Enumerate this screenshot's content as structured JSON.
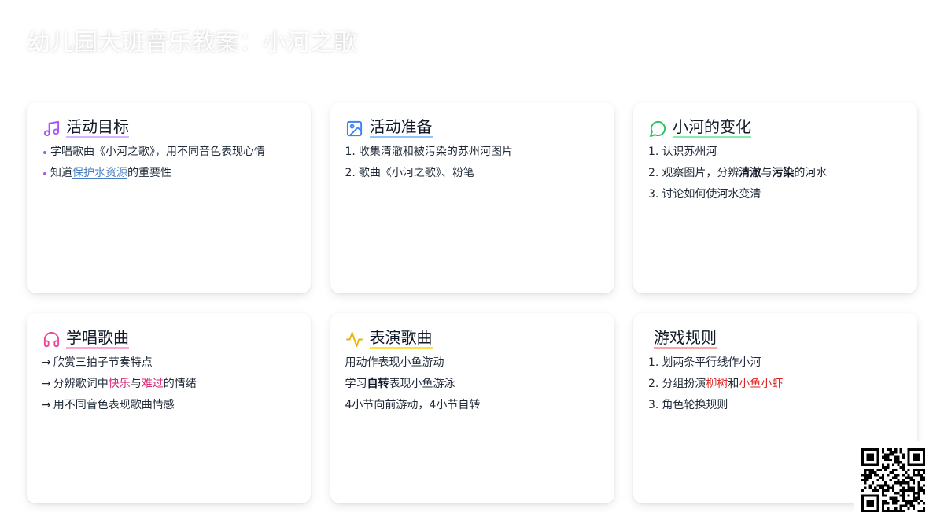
{
  "page": {
    "title": "幼儿园大班音乐教案：小河之歌"
  },
  "colors": {
    "page_background": "#ffffff",
    "text": "#1f2937",
    "heading": "#111827"
  },
  "cards": [
    {
      "icon": "music-icon",
      "title": "活动目标",
      "accent": "#a855f7",
      "underline": "#d8b4fe",
      "link_color": "#4a7fc1",
      "items": [
        {
          "segments": [
            {
              "text": "学唱歌曲《小河之歌》，用不同音色表现心情"
            }
          ]
        },
        {
          "segments": [
            {
              "text": "知道"
            },
            {
              "text": "保护水资源",
              "link": true
            },
            {
              "text": "的重要性"
            }
          ]
        }
      ]
    },
    {
      "icon": "image-icon",
      "title": "活动准备",
      "accent": "#3b82f6",
      "underline": "#93c5fd",
      "items": [
        {
          "marker": "1.",
          "segments": [
            {
              "text": "收集清澈和被污染的苏州河图片"
            }
          ]
        },
        {
          "marker": "2.",
          "segments": [
            {
              "text": "歌曲《小河之歌》、粉笔"
            }
          ]
        }
      ]
    },
    {
      "icon": "message-circle-icon",
      "title": "小河的变化",
      "accent": "#22c55e",
      "underline": "#86efac",
      "items": [
        {
          "marker": "1.",
          "segments": [
            {
              "text": "认识苏州河"
            }
          ]
        },
        {
          "marker": "2.",
          "segments": [
            {
              "text": "观察图片，分辨"
            },
            {
              "text": "清澈",
              "bold": true
            },
            {
              "text": "与"
            },
            {
              "text": "污染",
              "bold": true
            },
            {
              "text": "的河水"
            }
          ]
        },
        {
          "marker": "3.",
          "segments": [
            {
              "text": "讨论如何使河水变清"
            }
          ]
        }
      ]
    },
    {
      "icon": "headphones-icon",
      "title": "学唱歌曲",
      "accent": "#ec4899",
      "underline": "#f9a8d4",
      "link_color": "#db2777",
      "items": [
        {
          "marker": "→",
          "segments": [
            {
              "text": "欣赏三拍子节奏特点"
            }
          ]
        },
        {
          "marker": "→",
          "segments": [
            {
              "text": "分辨歌词中"
            },
            {
              "text": "快乐",
              "link": true
            },
            {
              "text": "与"
            },
            {
              "text": "难过",
              "link": true
            },
            {
              "text": "的情绪"
            }
          ]
        },
        {
          "marker": "→",
          "segments": [
            {
              "text": "用不同音色表现歌曲情感"
            }
          ]
        }
      ]
    },
    {
      "icon": "activity-icon",
      "title": "表演歌曲",
      "accent": "#eab308",
      "underline": "#fde047",
      "items": [
        {
          "segments": [
            {
              "text": "用动作表现小鱼游动"
            }
          ]
        },
        {
          "segments": [
            {
              "text": "学习"
            },
            {
              "text": "自转",
              "bold": true
            },
            {
              "text": "表现小鱼游泳"
            }
          ]
        },
        {
          "segments": [
            {
              "text": "4小节向前游动，4小节自转"
            }
          ]
        }
      ]
    },
    {
      "title": "游戏规则",
      "underline": "#fca5a5",
      "link_color": "#dc2626",
      "items": [
        {
          "marker": "1.",
          "segments": [
            {
              "text": "划两条平行线作小河"
            }
          ]
        },
        {
          "marker": "2.",
          "segments": [
            {
              "text": "分组扮演"
            },
            {
              "text": "柳树",
              "link": true
            },
            {
              "text": "和"
            },
            {
              "text": "小鱼小虾",
              "link": true
            }
          ]
        },
        {
          "marker": "3.",
          "segments": [
            {
              "text": "角色轮换规则"
            }
          ]
        }
      ]
    }
  ],
  "qr_code": {
    "icon": "qr-code-icon"
  }
}
